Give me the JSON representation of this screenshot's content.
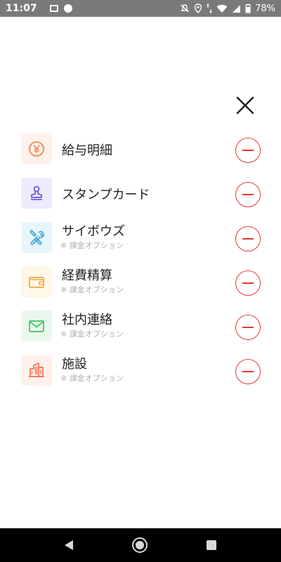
{
  "status_bar": {
    "time": "11:07",
    "battery": "78%"
  },
  "colors": {
    "remove_accent": "#e33a3a",
    "salary_tile": "#fff1ec",
    "stamp_tile": "#eeebfd",
    "cybozu_tile": "#e8f6fb",
    "expense_tile": "#fff7e8",
    "message_tile": "#eaf7ec",
    "facility_tile": "#fff0ec"
  },
  "items": [
    {
      "title": "給与明細",
      "subtitle": "",
      "icon": "yen-coin-icon"
    },
    {
      "title": "スタンプカード",
      "subtitle": "",
      "icon": "stamp-icon"
    },
    {
      "title": "サイボウズ",
      "subtitle": "※ 課金オプション",
      "icon": "tools-icon"
    },
    {
      "title": "経費精算",
      "subtitle": "※ 課金オプション",
      "icon": "wallet-icon"
    },
    {
      "title": "社内連絡",
      "subtitle": "※ 課金オプション",
      "icon": "mail-icon"
    },
    {
      "title": "施設",
      "subtitle": "※ 課金オプション",
      "icon": "building-icon"
    }
  ]
}
